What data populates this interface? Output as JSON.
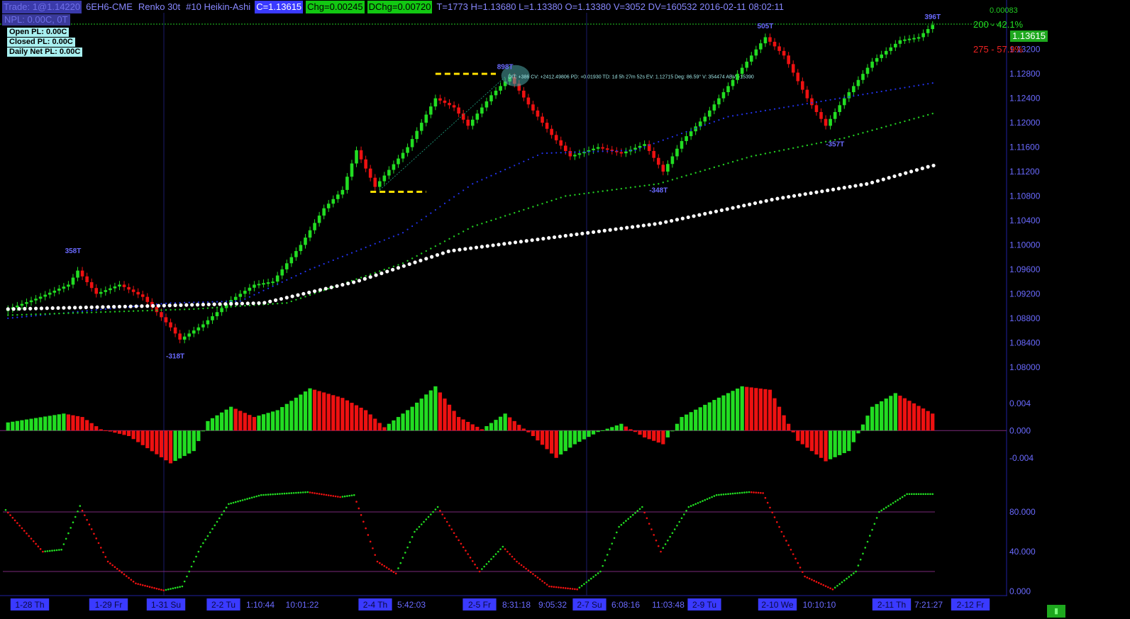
{
  "header": {
    "trade": "Trade: 1@1.14220",
    "symbol": "6EH6-CME",
    "bar_type": "Renko 30t",
    "study": "#10 Heikin-Ashi",
    "close": "C=1.13615",
    "chg": "Chg=0.00245",
    "dchg": "DChg=0.00720",
    "stats": "T=1773 H=1.13680 L=1.13380 O=1.13380 V=3052 DV=160532 2016-02-11 08:02:11"
  },
  "npl": "NPL: 0.00C, 0T",
  "pl_boxes": {
    "open": "Open PL: 0.00C",
    "closed": "Closed PL: 0.00C",
    "daily": "Daily Net PL: 0.00C"
  },
  "current_price_label": "1.13615",
  "targets": {
    "partial_top": "0.00083",
    "upper": "200 - 42.1%",
    "lower": "275 - 57.9%"
  },
  "annotation_text": "DIT: +386  CV: +2412.49806  PD: +0.01930  TD: 1d 5h 27m 52s  EV: 1.12715  Deg: 86.59°  V: 354474  ABV: -15390",
  "colors": {
    "up": "#22dd22",
    "down": "#ee1111",
    "ma_fast": "#2233ee",
    "ma_mid": "#22cc22",
    "ma_slow": "#ffffff",
    "trend": "#ffe000",
    "label": "#6a6aff"
  },
  "chart_data": [
    {
      "type": "candlestick",
      "title": "",
      "ylim": [
        1.078,
        1.138
      ],
      "y_ticks": [
        "1.13200",
        "1.12800",
        "1.12400",
        "1.12000",
        "1.11600",
        "1.11200",
        "1.10800",
        "1.10400",
        "1.10000",
        "1.09600",
        "1.09200",
        "1.08800",
        "1.08400",
        "1.08000"
      ],
      "y_tick_values": [
        1.132,
        1.128,
        1.124,
        1.12,
        1.116,
        1.112,
        1.108,
        1.104,
        1.1,
        1.096,
        1.092,
        1.088,
        1.084,
        1.08
      ],
      "bars_count": 200,
      "close_anchors": [
        [
          0,
          1.0895
        ],
        [
          6,
          1.0912
        ],
        [
          13,
          1.0935
        ],
        [
          15,
          1.0958
        ],
        [
          19,
          1.092
        ],
        [
          24,
          1.0935
        ],
        [
          29,
          1.0915
        ],
        [
          35,
          1.0865
        ],
        [
          37,
          1.0845
        ],
        [
          42,
          1.087
        ],
        [
          48,
          1.091
        ],
        [
          53,
          1.0935
        ],
        [
          57,
          1.094
        ],
        [
          63,
          1.1
        ],
        [
          68,
          1.106
        ],
        [
          72,
          1.109
        ],
        [
          75,
          1.1155
        ],
        [
          79,
          1.1095
        ],
        [
          86,
          1.116
        ],
        [
          92,
          1.124
        ],
        [
          96,
          1.1225
        ],
        [
          99,
          1.1195
        ],
        [
          104,
          1.1245
        ],
        [
          108,
          1.1275
        ],
        [
          112,
          1.123
        ],
        [
          117,
          1.118
        ],
        [
          121,
          1.1145
        ],
        [
          127,
          1.116
        ],
        [
          132,
          1.115
        ],
        [
          137,
          1.1165
        ],
        [
          141,
          1.112
        ],
        [
          145,
          1.117
        ],
        [
          150,
          1.121
        ],
        [
          156,
          1.127
        ],
        [
          161,
          1.132
        ],
        [
          163,
          1.134
        ],
        [
          167,
          1.131
        ],
        [
          172,
          1.124
        ],
        [
          176,
          1.1195
        ],
        [
          180,
          1.124
        ],
        [
          186,
          1.13
        ],
        [
          192,
          1.1335
        ],
        [
          196,
          1.134
        ],
        [
          199,
          1.136
        ]
      ],
      "swing_labels": [
        {
          "bar": 14,
          "price": 1.0982,
          "text": "358T",
          "pos": "above"
        },
        {
          "bar": 36,
          "price": 1.0828,
          "text": "-318T",
          "pos": "below"
        },
        {
          "bar": 107,
          "price": 1.1283,
          "text": "898T",
          "pos": "above"
        },
        {
          "bar": 140,
          "price": 1.11,
          "text": "-348T",
          "pos": "below"
        },
        {
          "bar": 163,
          "price": 1.135,
          "text": "505T",
          "pos": "above"
        },
        {
          "bar": 178,
          "price": 1.1175,
          "text": "-357T",
          "pos": "below"
        },
        {
          "bar": 199,
          "price": 1.1365,
          "text": "396T",
          "pos": "above"
        }
      ],
      "ma_fast": [
        [
          0,
          1.088
        ],
        [
          35,
          1.0905
        ],
        [
          50,
          1.0908
        ],
        [
          65,
          1.096
        ],
        [
          85,
          1.102
        ],
        [
          100,
          1.11
        ],
        [
          115,
          1.115
        ],
        [
          135,
          1.1155
        ],
        [
          155,
          1.121
        ],
        [
          175,
          1.1235
        ],
        [
          199,
          1.1265
        ]
      ],
      "ma_mid": [
        [
          0,
          1.0885
        ],
        [
          40,
          1.0895
        ],
        [
          60,
          1.0905
        ],
        [
          85,
          1.097
        ],
        [
          100,
          1.103
        ],
        [
          120,
          1.108
        ],
        [
          140,
          1.11
        ],
        [
          160,
          1.1145
        ],
        [
          180,
          1.1175
        ],
        [
          199,
          1.1215
        ]
      ],
      "ma_slow": [
        [
          0,
          1.0895
        ],
        [
          30,
          1.09
        ],
        [
          55,
          1.0905
        ],
        [
          75,
          1.094
        ],
        [
          95,
          1.099
        ],
        [
          115,
          1.101
        ],
        [
          140,
          1.1035
        ],
        [
          165,
          1.1075
        ],
        [
          185,
          1.11
        ],
        [
          199,
          1.113
        ]
      ]
    },
    {
      "type": "bar",
      "title": "",
      "ylim": [
        -0.006,
        0.007
      ],
      "y_ticks": [
        "0.004",
        "0.000",
        "-0.004"
      ],
      "y_tick_values": [
        0.004,
        0.0,
        -0.004
      ],
      "anchors": [
        [
          0,
          0.0012
        ],
        [
          12,
          0.0025
        ],
        [
          16,
          0.002
        ],
        [
          20,
          0.0002
        ],
        [
          26,
          -0.0008
        ],
        [
          35,
          -0.0048
        ],
        [
          40,
          -0.003
        ],
        [
          43,
          0.0014
        ],
        [
          48,
          0.0035
        ],
        [
          53,
          0.002
        ],
        [
          58,
          0.003
        ],
        [
          65,
          0.0062
        ],
        [
          72,
          0.0048
        ],
        [
          77,
          0.003
        ],
        [
          81,
          0.0005
        ],
        [
          87,
          0.0035
        ],
        [
          92,
          0.0065
        ],
        [
          97,
          0.002
        ],
        [
          102,
          0.0002
        ],
        [
          107,
          0.0025
        ],
        [
          113,
          -0.0008
        ],
        [
          118,
          -0.004
        ],
        [
          122,
          -0.002
        ],
        [
          127,
          -0.0002
        ],
        [
          132,
          0.001
        ],
        [
          137,
          -0.001
        ],
        [
          141,
          -0.002
        ],
        [
          145,
          0.002
        ],
        [
          152,
          0.0045
        ],
        [
          158,
          0.0065
        ],
        [
          164,
          0.006
        ],
        [
          170,
          -0.0015
        ],
        [
          176,
          -0.0045
        ],
        [
          181,
          -0.003
        ],
        [
          186,
          0.0035
        ],
        [
          191,
          0.0055
        ],
        [
          199,
          0.0025
        ]
      ]
    },
    {
      "type": "line",
      "title": "",
      "ylim": [
        0,
        100
      ],
      "y_ticks": [
        "80.000",
        "40.000",
        "0.000"
      ],
      "y_tick_values": [
        80,
        40,
        0
      ],
      "levels": [
        80,
        20
      ],
      "anchors": [
        [
          0,
          82
        ],
        [
          8,
          40
        ],
        [
          12,
          42
        ],
        [
          16,
          86
        ],
        [
          22,
          30
        ],
        [
          28,
          8
        ],
        [
          34,
          1
        ],
        [
          38,
          5
        ],
        [
          42,
          45
        ],
        [
          48,
          88
        ],
        [
          55,
          97
        ],
        [
          65,
          100
        ],
        [
          72,
          95
        ],
        [
          75,
          97
        ],
        [
          80,
          30
        ],
        [
          84,
          18
        ],
        [
          88,
          60
        ],
        [
          93,
          85
        ],
        [
          97,
          55
        ],
        [
          102,
          20
        ],
        [
          107,
          45
        ],
        [
          110,
          30
        ],
        [
          117,
          5
        ],
        [
          123,
          2
        ],
        [
          128,
          20
        ],
        [
          132,
          65
        ],
        [
          137,
          85
        ],
        [
          141,
          40
        ],
        [
          147,
          85
        ],
        [
          153,
          97
        ],
        [
          160,
          100
        ],
        [
          163,
          99
        ],
        [
          167,
          60
        ],
        [
          172,
          15
        ],
        [
          178,
          2
        ],
        [
          183,
          20
        ],
        [
          188,
          80
        ],
        [
          194,
          98
        ],
        [
          199,
          98
        ]
      ]
    }
  ],
  "x_axis": {
    "labels": [
      {
        "text": "1-28 Th",
        "boxed": true
      },
      {
        "text": "1-29 Fr",
        "boxed": true
      },
      {
        "text": "1-31 Su",
        "boxed": true
      },
      {
        "text": "2-2 Tu",
        "boxed": true
      },
      {
        "text": "1:10:44",
        "boxed": false
      },
      {
        "text": "10:01:22",
        "boxed": false
      },
      {
        "text": "2-4 Th",
        "boxed": true
      },
      {
        "text": "5:42:03",
        "boxed": false
      },
      {
        "text": "2-5 Fr",
        "boxed": true
      },
      {
        "text": "8:31:18",
        "boxed": false
      },
      {
        "text": "9:05:32",
        "boxed": false
      },
      {
        "text": "2-7 Su",
        "boxed": true
      },
      {
        "text": "6:08:16",
        "boxed": false
      },
      {
        "text": "11:03:48",
        "boxed": false
      },
      {
        "text": "2-9 Tu",
        "boxed": true
      },
      {
        "text": "2-10 We",
        "boxed": true
      },
      {
        "text": "10:10:10",
        "boxed": false
      },
      {
        "text": "2-11 Th",
        "boxed": true
      },
      {
        "text": "7:21:27",
        "boxed": false
      },
      {
        "text": "2-12 Fr",
        "boxed": true
      }
    ]
  }
}
